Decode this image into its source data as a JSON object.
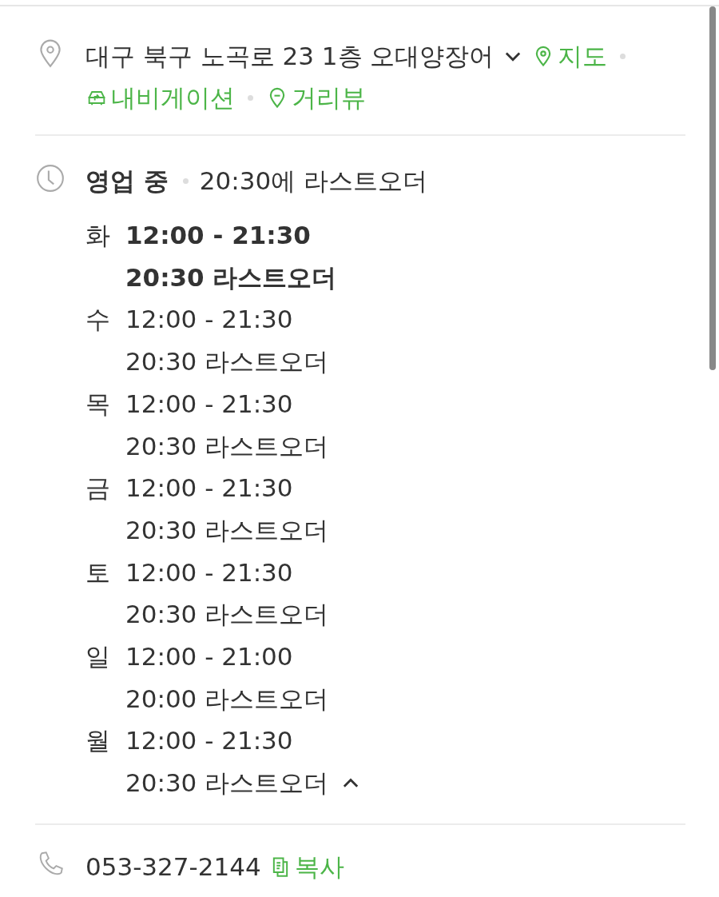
{
  "address": {
    "text": "대구 북구 노곡로 23 1층 오대양장어",
    "expanded": false,
    "links": [
      {
        "kind": "map",
        "label": "지도"
      },
      {
        "kind": "navigation",
        "label": "내비게이션"
      },
      {
        "kind": "street",
        "label": "거리뷰"
      }
    ]
  },
  "hours": {
    "status": "영업 중",
    "note": "20:30에 라스트오더",
    "expanded": true,
    "days": [
      {
        "day": "화",
        "time": "12:00 - 21:30",
        "last_order": "20:30 라스트오더",
        "selected": true
      },
      {
        "day": "수",
        "time": "12:00 - 21:30",
        "last_order": "20:30 라스트오더",
        "selected": false
      },
      {
        "day": "목",
        "time": "12:00 - 21:30",
        "last_order": "20:30 라스트오더",
        "selected": false
      },
      {
        "day": "금",
        "time": "12:00 - 21:30",
        "last_order": "20:30 라스트오더",
        "selected": false
      },
      {
        "day": "토",
        "time": "12:00 - 21:30",
        "last_order": "20:30 라스트오더",
        "selected": false
      },
      {
        "day": "일",
        "time": "12:00 - 21:00",
        "last_order": "20:00 라스트오더",
        "selected": false
      },
      {
        "day": "월",
        "time": "12:00 - 21:30",
        "last_order": "20:30 라스트오더",
        "selected": false
      }
    ]
  },
  "phone": {
    "number": "053-327-2144",
    "copy_label": "복사"
  }
}
